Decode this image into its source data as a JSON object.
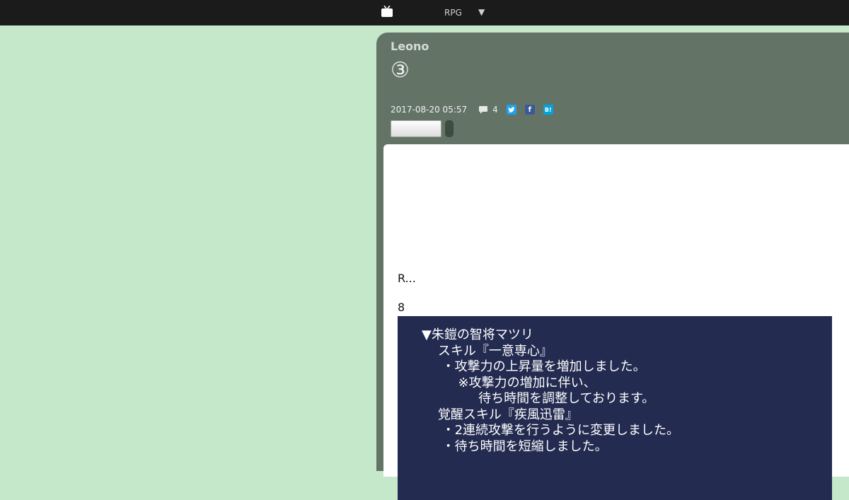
{
  "topbar": {
    "logo_icon": "tv-icon",
    "category": "RPG",
    "dropdown": "▼"
  },
  "article": {
    "author": "Leono",
    "title": "③",
    "date": "2017-08-20 05:57",
    "comment_icon": "comment-icon",
    "comment_count": "4",
    "share": {
      "twitter": "twitter-icon",
      "facebook": "f",
      "hatena": "B!"
    },
    "excerpt": "R...",
    "number": "8",
    "notice_lines": [
      "▼朱鎧の智将マツリ",
      "    スキル『一意専心』",
      "     ・攻撃力の上昇量を増加しました。",
      "         ※攻撃力の増加に伴い、",
      "              待ち時間を調整しております。",
      "    覚醒スキル『疾風迅雷』",
      "     ・2連続攻撃を行うように変更しました。",
      "     ・待ち時間を短縮しました。"
    ]
  },
  "colors": {
    "background": "#c5e8cb",
    "topbar": "#1b1b1b",
    "card": "#637467",
    "notice_bg": "#232b50"
  }
}
